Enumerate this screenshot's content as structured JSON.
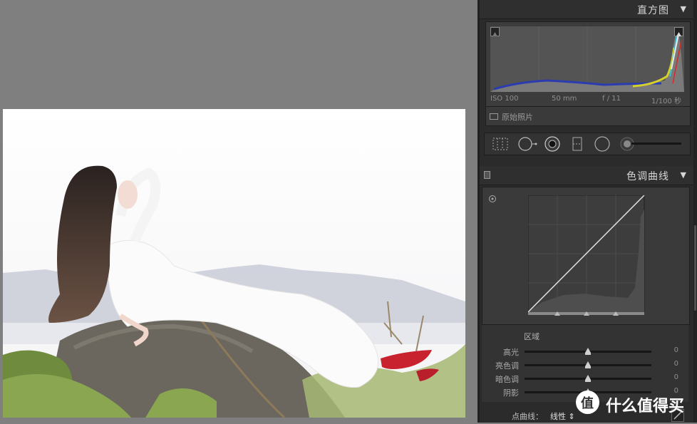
{
  "histogram_panel": {
    "title": "直方图",
    "exif": {
      "iso": "ISO 100",
      "focal": "50 mm",
      "aperture": "f / 11",
      "shutter": "1/100 秒"
    },
    "original_photo_label": "原始照片"
  },
  "tone_curve_panel": {
    "title": "色调曲线",
    "regions_title": "区域",
    "regions": [
      {
        "label": "高光",
        "value": "0"
      },
      {
        "label": "亮色调",
        "value": "0"
      },
      {
        "label": "暗色调",
        "value": "0"
      },
      {
        "label": "阴影",
        "value": "0"
      }
    ],
    "point_curve_label": "点曲线：",
    "point_curve_value": "线性"
  },
  "watermark": {
    "logo_glyph": "值",
    "text": "什么值得买"
  },
  "colors": {
    "panel_bg": "#2b2b2b",
    "canvas_bg": "#7f7f7f"
  }
}
